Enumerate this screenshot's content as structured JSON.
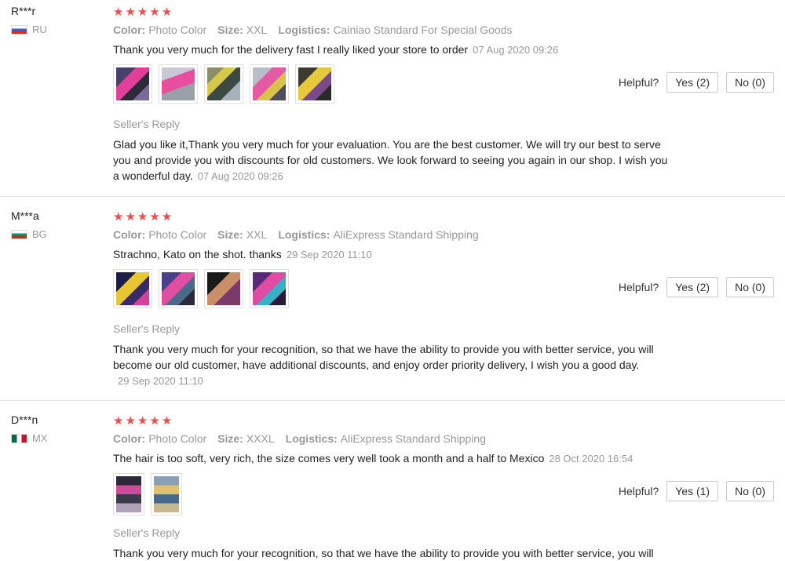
{
  "labels": {
    "color": "Color:",
    "size": "Size:",
    "logistics": "Logistics:",
    "seller_reply": "Seller's Reply",
    "helpful": "Helpful?"
  },
  "reviews": [
    {
      "user": "R***r",
      "country": "RU",
      "rating": "★★★★★",
      "color": "Photo Color",
      "size": "XXL",
      "logistics": "Cainiao Standard For Special Goods",
      "text": "Thank you very much for the delivery fast I really liked your store to order",
      "date": "07 Aug 2020 09:26",
      "reply": "Glad you like it,Thank you very much for your evaluation. You are the best customer. We will try our best to serve you and provide you with discounts for old customers. We look forward to seeing you again in our shop. I wish you a wonderful day.",
      "reply_date": "07 Aug 2020 09:26",
      "yes": "Yes (2)",
      "no": "No (0)"
    },
    {
      "user": "M***a",
      "country": "BG",
      "rating": "★★★★★",
      "color": "Photo Color",
      "size": "XXL",
      "logistics": "AliExpress Standard Shipping",
      "text": "Strachno, Kato on the shot. thanks",
      "date": "29 Sep 2020 11:10",
      "reply": "Thank you very much for your recognition, so that we have the ability to provide you with better service, you will become our old customer, have additional discounts, and enjoy order priority delivery, I wish you a good day.",
      "reply_date": "29 Sep 2020 11:10",
      "yes": "Yes (2)",
      "no": "No (0)"
    },
    {
      "user": "D***n",
      "country": "MX",
      "rating": "★★★★★",
      "color": "Photo Color",
      "size": "XXXL",
      "logistics": "AliExpress Standard Shipping",
      "text": "The hair is too soft, very rich, the size comes very well took a month and a half to Mexico",
      "date": "28 Oct 2020 16:54",
      "reply": "Thank you very much for your recognition, so that we have the ability to provide you with better service, you will",
      "yes": "Yes (1)",
      "no": "No (0)"
    }
  ]
}
